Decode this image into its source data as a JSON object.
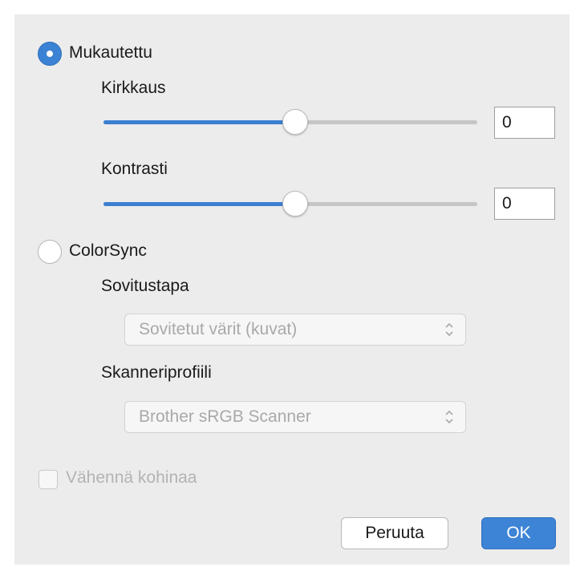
{
  "custom": {
    "label": "Mukautettu",
    "selected": true
  },
  "brightness": {
    "label": "Kirkkaus",
    "value": "0",
    "slider_fraction": 0.5
  },
  "contrast": {
    "label": "Kontrasti",
    "value": "0",
    "slider_fraction": 0.5
  },
  "colorsync": {
    "label": "ColorSync",
    "selected": false
  },
  "rendering": {
    "label": "Sovitustapa",
    "selected_option": "Sovitetut värit (kuvat)",
    "enabled": false
  },
  "scanner_profile": {
    "label": "Skanneriprofiili",
    "selected_option": "Brother sRGB Scanner",
    "enabled": false
  },
  "noise_reduction": {
    "label": "Vähennä kohinaa",
    "checked": false,
    "enabled": false
  },
  "buttons": {
    "cancel": "Peruuta",
    "ok": "OK"
  },
  "colors": {
    "accent": "#3b82d4",
    "disabled_text": "#a9a9a9"
  }
}
